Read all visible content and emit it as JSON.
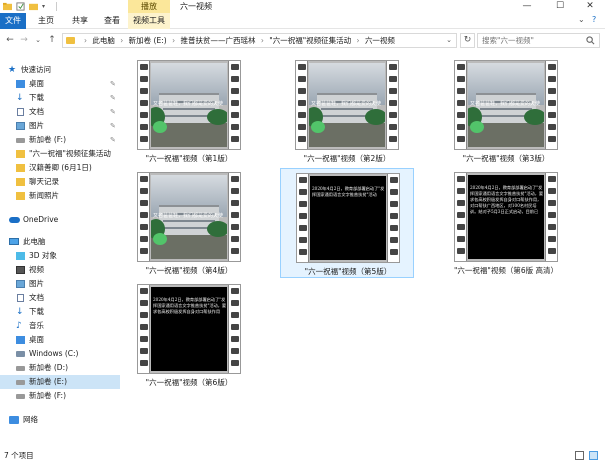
{
  "titlebar": {
    "context_tab": "播放",
    "title": "六一视频",
    "minimize": "—",
    "maximize": "☐",
    "close": "✕"
  },
  "ribbon": {
    "tabs": [
      "文件",
      "主页",
      "共享",
      "查看",
      "视频工具"
    ],
    "collapse": "⌄",
    "help": "?"
  },
  "nav": {
    "back": "←",
    "forward": "→",
    "recent": "⌄",
    "up": "↑",
    "breadcrumbs": [
      "此电脑",
      "新加卷 (E:)",
      "推普扶贫——广西瑶林",
      "\"六一祝福\"视频征集活动",
      "六一视频"
    ],
    "refresh": "↻",
    "search_placeholder": "搜索\"六一视频\""
  },
  "sidebar": {
    "items": [
      {
        "label": "快速访问",
        "pinned": false
      },
      {
        "label": "桌面",
        "pinned": true
      },
      {
        "label": "下载",
        "pinned": true
      },
      {
        "label": "文档",
        "pinned": true
      },
      {
        "label": "图片",
        "pinned": true
      },
      {
        "label": "新加卷 (F:)",
        "pinned": true
      },
      {
        "label": "\"六一祝福\"视频征集活动",
        "pinned": false
      },
      {
        "label": "汉籍善卿 (6月1日)",
        "pinned": false
      },
      {
        "label": "聊天记录",
        "pinned": false
      },
      {
        "label": "新闻照片",
        "pinned": false
      },
      {
        "label": "OneDrive",
        "pinned": false
      },
      {
        "label": "此电脑",
        "pinned": false
      },
      {
        "label": "3D 对象",
        "pinned": false
      },
      {
        "label": "视频",
        "pinned": false
      },
      {
        "label": "图片",
        "pinned": false
      },
      {
        "label": "文档",
        "pinned": false
      },
      {
        "label": "下载",
        "pinned": false
      },
      {
        "label": "音乐",
        "pinned": false
      },
      {
        "label": "桌面",
        "pinned": false
      },
      {
        "label": "Windows (C:)",
        "pinned": false
      },
      {
        "label": "新加卷 (D:)",
        "pinned": false
      },
      {
        "label": "新加卷 (E:)",
        "pinned": false
      },
      {
        "label": "新加卷 (F:)",
        "pinned": false
      },
      {
        "label": "网络",
        "pinned": false
      }
    ],
    "pin_glyph": "✎"
  },
  "files": [
    {
      "name": "\"六一祝福\"视频（第1版）",
      "kind": "photo",
      "caption": "又名爸爸鞋，我们都是爱的天使"
    },
    {
      "name": "\"六一祝福\"视频（第2版）",
      "kind": "photo",
      "caption": "又名爸爸鞋，我们都是爱的天使"
    },
    {
      "name": "\"六一祝福\"视频（第3版）",
      "kind": "photo",
      "caption": "又名爸爸鞋，我们都是爱的天使"
    },
    {
      "name": "\"六一祝福\"视频（第4版）",
      "kind": "photo",
      "caption": "又名爸爸鞋，我们都是爱的天使"
    },
    {
      "name": "\"六一祝福\"视频（第5版）",
      "kind": "text",
      "caption": "2020年4月2日，教育部部署启动了\"发挥国家通用语言文字推普扶贫\"活动"
    },
    {
      "name": "\"六一祝福\"视频（第6版 高清）",
      "kind": "text",
      "caption": "2020年4月2日，教育部部署启动了\"发挥国家通用语言文字推普扶贫\"活动，要求各高校积极发挥自身对口帮扶作用，对口帮扶广西地区，对100名村民培训。结对子5月3日正式启动，目前已"
    },
    {
      "name": "\"六一祝福\"视频（第6版）",
      "kind": "text",
      "caption": "2020年4月2日，教育部部署启动了\"发挥国家通用语言文字推普扶贫\"活动，要求各高校积极发挥自身对口帮扶作用"
    }
  ],
  "status": {
    "count": "7 个项目"
  }
}
